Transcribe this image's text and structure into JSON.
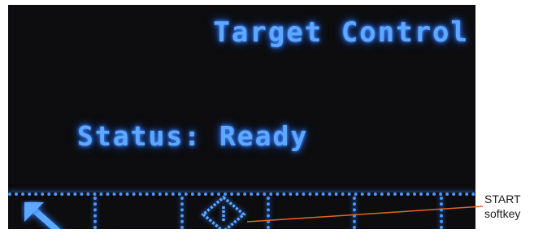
{
  "display": {
    "title": "Target Control",
    "status_line": "Status: Ready"
  },
  "softkeys": [
    {
      "index": 1,
      "icon": "escape-arrow-icon"
    },
    {
      "index": 2,
      "icon": "none"
    },
    {
      "index": 3,
      "icon": "start-diamond-icon"
    },
    {
      "index": 4,
      "icon": "none"
    },
    {
      "index": 5,
      "icon": "none"
    },
    {
      "index": 6,
      "icon": "none"
    }
  ],
  "callout": {
    "line1": "START",
    "line2": "softkey"
  },
  "colors": {
    "display_background": "#0d0d0f",
    "display_glow": "#5fa8ff",
    "callout_line": "#e8651e",
    "page_background": "#ffffff"
  }
}
